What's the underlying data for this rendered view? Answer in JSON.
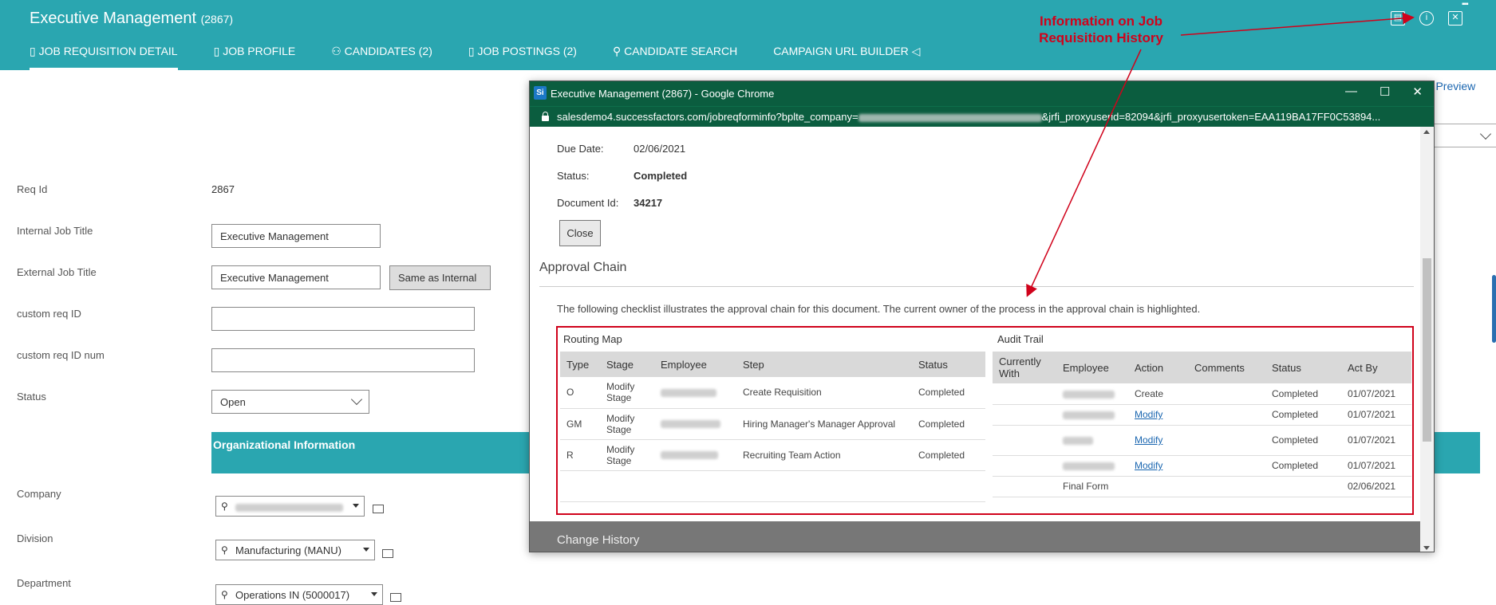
{
  "header": {
    "title": "Executive Management",
    "title_id": "(2867)",
    "tabs": [
      {
        "label": "JOB REQUISITION DETAIL",
        "icon": "document-icon"
      },
      {
        "label": "JOB PROFILE",
        "icon": "profile-icon"
      },
      {
        "label": "CANDIDATES (2)",
        "icon": "people-icon"
      },
      {
        "label": "JOB POSTINGS (2)",
        "icon": "posting-icon"
      },
      {
        "label": "CANDIDATE SEARCH",
        "icon": "search-icon"
      },
      {
        "label": "CAMPAIGN URL BUILDER",
        "icon": "megaphone-icon"
      }
    ]
  },
  "annotation": {
    "line1": "Information on Job",
    "line2": "Requisition History"
  },
  "form": {
    "req_id_label": "Req Id",
    "req_id_value": "2867",
    "internal_title_label": "Internal Job Title",
    "internal_title_value": "Executive Management",
    "external_title_label": "External Job Title",
    "external_title_value": "Executive Management",
    "same_as_internal": "Same as Internal",
    "custom_req_id_label": "custom req ID",
    "custom_req_id_num_label": "custom req ID num",
    "status_label": "Status",
    "status_value": "Open",
    "org_info": "Organizational Information",
    "company_label": "Company",
    "division_label": "Division",
    "division_value": "Manufacturing (MANU)",
    "department_label": "Department",
    "department_value": "Operations IN (5000017)"
  },
  "right_panel": {
    "preview_link": "ng Preview"
  },
  "popup": {
    "window_title": "Executive Management (2867) - Google Chrome",
    "url_prefix": "salesdemo4.successfactors.com/jobreqforminfo?bplte_company=",
    "url_suffix": "&jrfi_proxyuserid=82094&jrfi_proxyusertoken=EAA119BA17FF0C53894...",
    "due_date_label": "Due Date:",
    "due_date_value": "02/06/2021",
    "status_label": "Status:",
    "status_value": "Completed",
    "doc_id_label": "Document Id:",
    "doc_id_value": "34217",
    "close_label": "Close",
    "approval_chain_title": "Approval Chain",
    "description": "The following checklist illustrates the approval chain for this document. The current owner of the process in the approval chain is highlighted.",
    "routing_map": {
      "title": "Routing Map",
      "columns": [
        "Type",
        "Stage",
        "Employee",
        "Step",
        "Status"
      ],
      "rows": [
        {
          "type": "O",
          "stage": "Modify Stage",
          "step": "Create Requisition",
          "status": "Completed"
        },
        {
          "type": "GM",
          "stage": "Modify Stage",
          "step": "Hiring Manager's Manager Approval",
          "status": "Completed"
        },
        {
          "type": "R",
          "stage": "Modify Stage",
          "step": "Recruiting Team Action",
          "status": "Completed"
        }
      ]
    },
    "audit_trail": {
      "title": "Audit Trail",
      "columns": [
        "Currently With",
        "Employee",
        "Action",
        "Comments",
        "Status",
        "Act By"
      ],
      "rows": [
        {
          "action": "Create",
          "status": "Completed",
          "act_by": "01/07/2021"
        },
        {
          "action": "Modify",
          "status": "Completed",
          "act_by": "01/07/2021"
        },
        {
          "action": "Modify",
          "status": "Completed",
          "act_by": "01/07/2021"
        },
        {
          "action": "Modify",
          "status": "Completed",
          "act_by": "01/07/2021"
        }
      ],
      "final_form_label": "Final Form",
      "final_form_date": "02/06/2021"
    },
    "change_history_title": "Change History"
  },
  "colors": {
    "header": "#2aa6b0",
    "popup_title": "#0b5d3f",
    "annotation": "#d0021b",
    "link": "#1a66b0"
  }
}
